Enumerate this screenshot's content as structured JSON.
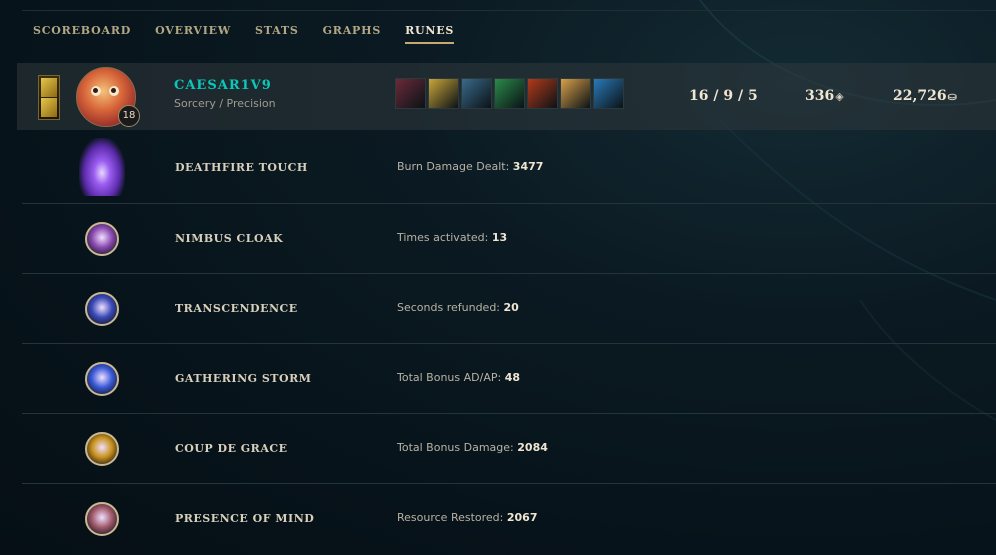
{
  "nav": {
    "tabs": [
      {
        "label": "SCOREBOARD"
      },
      {
        "label": "OVERVIEW"
      },
      {
        "label": "STATS"
      },
      {
        "label": "GRAPHS"
      },
      {
        "label": "RUNES",
        "active": true
      }
    ]
  },
  "player": {
    "name": "CAESAR1V9",
    "subtitle": "Sorcery / Precision",
    "level": "18",
    "kda": "16 / 9 / 5",
    "cs": "336",
    "gold": "22,726",
    "item_colors": [
      "#6a2a3a",
      "#c9a53a",
      "#3a6a8a",
      "#2a8a4a",
      "#b23a1a",
      "#d8a04a",
      "#2a7ab8"
    ]
  },
  "runes": [
    {
      "name": "DEATHFIRE TOUCH",
      "stat_label": "Burn Damage Dealt:",
      "stat_value": "3477",
      "icon": "deathfire-touch-icon",
      "color": "#7a3ae0"
    },
    {
      "name": "NIMBUS CLOAK",
      "stat_label": "Times activated:",
      "stat_value": "13",
      "icon": "nimbus-cloak-icon",
      "color": "#8a4ab0"
    },
    {
      "name": "TRANSCENDENCE",
      "stat_label": "Seconds refunded:",
      "stat_value": "20",
      "icon": "transcendence-icon",
      "color": "#3a4ab8"
    },
    {
      "name": "GATHERING STORM",
      "stat_label": "Total Bonus AD/AP:",
      "stat_value": "48",
      "icon": "gathering-storm-icon",
      "color": "#3a5ad8"
    },
    {
      "name": "COUP DE GRACE",
      "stat_label": "Total Bonus Damage:",
      "stat_value": "2084",
      "icon": "coup-de-grace-icon",
      "color": "#c8901a"
    },
    {
      "name": "PRESENCE OF MIND",
      "stat_label": "Resource Restored:",
      "stat_value": "2067",
      "icon": "presence-of-mind-icon",
      "color": "#a05a6a"
    }
  ]
}
